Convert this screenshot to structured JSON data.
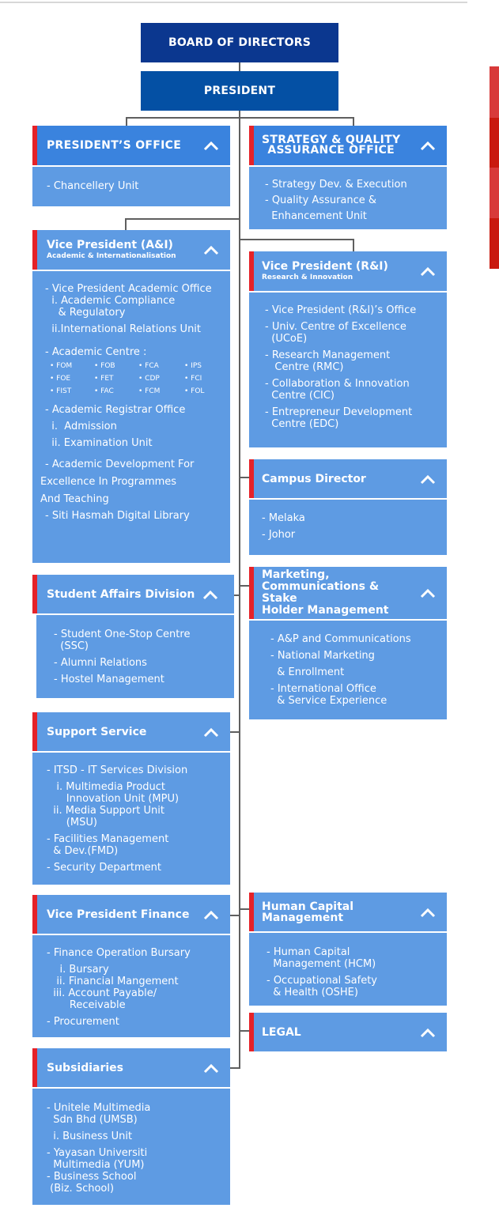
{
  "colors": {
    "board": "#0b378f",
    "president": "#0450a4",
    "unit_header": "#5e9be3",
    "unit_header_dark": "#3a83de",
    "accent_bar": "#e52228",
    "connector": "#5f5f5f"
  },
  "top": {
    "board_of_directors": "BOARD OF DIRECTORS",
    "president": "PRESIDENT"
  },
  "units": {
    "presidents_office": {
      "title": "PRESIDENT’S OFFICE",
      "items": [
        "- Chancellery Unit"
      ]
    },
    "strategy_quality": {
      "title_line1": "STRATEGY & QUALITY",
      "title_line2": "ASSURANCE OFFICE",
      "items": [
        "- Strategy Dev. & Execution",
        "- Quality Assurance &",
        "  Enhancement Unit"
      ]
    },
    "vp_ai": {
      "title": "Vice President (A&I)",
      "subtitle": "Academic & Internationalisation",
      "items": [
        "- Vice President Academic Office",
        "  i. Academic Compliance",
        "    & Regulatory",
        "  ii.International Relations Unit",
        "- Academic Centre :",
        "- Academic Registrar Office",
        "  i.  Admission",
        "  ii. Examination Unit",
        "- Academic Development For",
        "Excellence In Programmes",
        "And Teaching",
        "- Siti Hasmah Digital Library"
      ],
      "academic_centres": [
        "FOM",
        "FOB",
        "FCA",
        "IPS",
        "FOE",
        "FET",
        "CDP",
        "FCI",
        "FIST",
        "FAC",
        "FCM",
        "FOL"
      ]
    },
    "vp_ri": {
      "title": "Vice President (R&I)",
      "subtitle": "Research & Innovation",
      "items": [
        "- Vice President (R&I)’s Office",
        "- Univ. Centre of Excellence",
        "  (UCoE)",
        "- Research Management",
        "   Centre (RMC)",
        "- Collaboration & Innovation",
        "  Centre (CIC)",
        "- Entrepreneur Development",
        "  Centre (EDC)"
      ]
    },
    "campus_director": {
      "title": "Campus Director",
      "items": [
        "- Melaka",
        "- Johor"
      ]
    },
    "marketing": {
      "title_line1": "Marketing,",
      "title_line2": "Communications & Stake",
      "title_line3": "Holder Management",
      "items": [
        "- A&P and Communications",
        "- National Marketing",
        "  & Enrollment",
        "- International Office",
        "  & Service Experience"
      ]
    },
    "student_affairs": {
      "title": "Student Affairs Division",
      "items": [
        "- Student One-Stop Centre",
        "  (SSC)",
        "- Alumni Relations",
        "- Hostel Management"
      ]
    },
    "support_service": {
      "title": "Support Service",
      "items": [
        "- ITSD - IT Services Division",
        "   i. Multimedia Product",
        "      Innovation Unit (MPU)",
        "  ii. Media Support Unit",
        "      (MSU)",
        "- Facilities Management",
        "  & Dev.(FMD)",
        "- Security Department"
      ]
    },
    "vp_finance": {
      "title": "Vice President Finance",
      "items": [
        "- Finance Operation Bursary",
        "    i. Bursary",
        "   ii. Financial Mangement",
        "  iii. Account Payable/",
        "       Receivable",
        "- Procurement"
      ]
    },
    "human_capital": {
      "title_line1": "Human Capital",
      "title_line2": "Management",
      "items": [
        "- Human Capital",
        "  Management (HCM)",
        "- Occupational Safety",
        "  & Health (OSHE)"
      ]
    },
    "legal": {
      "title": "LEGAL"
    },
    "subsidiaries": {
      "title": "Subsidiaries",
      "items": [
        "- Unitele Multimedia",
        "  Sdn Bhd (UMSB)",
        "  i. Business Unit",
        "- Yayasan Universiti",
        "  Multimedia (YUM)",
        "- Business School",
        " (Biz. School)"
      ]
    }
  }
}
